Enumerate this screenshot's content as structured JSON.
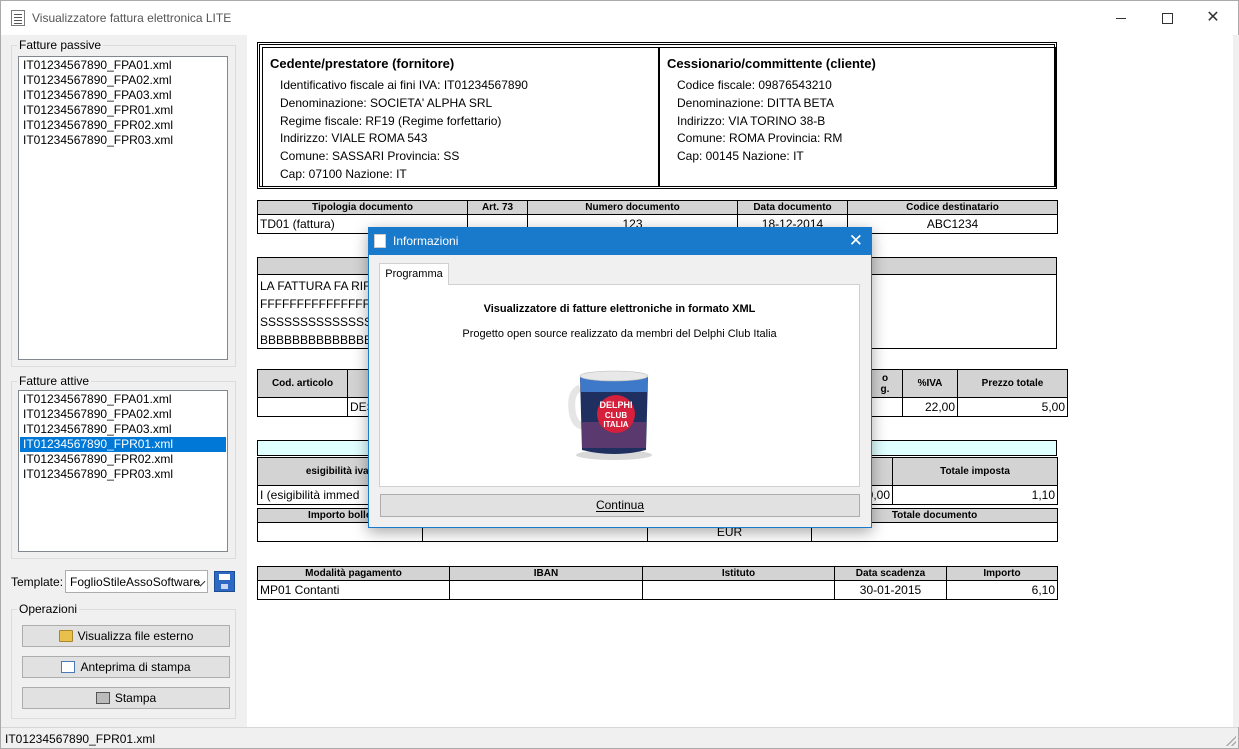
{
  "window": {
    "title": "Visualizzatore fattura elettronica LITE"
  },
  "sidebar": {
    "passive_label": "Fatture passive",
    "passive_items": [
      "IT01234567890_FPA01.xml",
      "IT01234567890_FPA02.xml",
      "IT01234567890_FPA03.xml",
      "IT01234567890_FPR01.xml",
      "IT01234567890_FPR02.xml",
      "IT01234567890_FPR03.xml"
    ],
    "active_label": "Fatture attive",
    "active_items": [
      "IT01234567890_FPA01.xml",
      "IT01234567890_FPA02.xml",
      "IT01234567890_FPA03.xml",
      "IT01234567890_FPR01.xml",
      "IT01234567890_FPR02.xml",
      "IT01234567890_FPR03.xml"
    ],
    "active_selected": "IT01234567890_FPR01.xml",
    "template_label": "Template:",
    "template_value": "FoglioStileAssoSoftware",
    "operations_label": "Operazioni",
    "btn_external": "Visualizza file esterno",
    "btn_preview": "Anteprima di stampa",
    "btn_print": "Stampa"
  },
  "invoice": {
    "cedente": {
      "heading": "Cedente/prestatore (fornitore)",
      "rows": [
        "Identificativo fiscale ai fini IVA: IT01234567890",
        "Denominazione: SOCIETA' ALPHA SRL",
        "Regime fiscale: RF19 (Regime forfettario)",
        "Indirizzo: VIALE ROMA 543",
        "Comune: SASSARI Provincia: SS",
        "Cap: 07100 Nazione: IT"
      ]
    },
    "cessionario": {
      "heading": "Cessionario/committente (cliente)",
      "rows": [
        "Codice fiscale: 09876543210",
        "Denominazione: DITTA BETA",
        "Indirizzo: VIA TORINO 38-B",
        "Comune: ROMA Provincia: RM",
        "Cap: 00145 Nazione: IT"
      ]
    },
    "doc_table": {
      "headers": [
        "Tipologia documento",
        "Art. 73",
        "Numero documento",
        "Data documento",
        "Codice destinatario"
      ],
      "row": [
        "TD01 (fattura)",
        "",
        "123",
        "18-12-2014",
        "ABC1234"
      ]
    },
    "causale_text": "LA FATTURA FA RIF                                                                                          DDDDDD E\nFFFFFFFFFFFFFFFF                                                                                             P QQQQ RRRR\nSSSSSSSSSSSSSSS                                                                                             ARATTERI AAAAAAAAAAA\nBBBBBBBBBBBBBB",
    "lines_table": {
      "headers": [
        "Cod. articolo",
        "",
        "o\ng.",
        "%IVA",
        "Prezzo totale"
      ],
      "row": [
        "",
        "DES",
        "",
        "22,00",
        "5,00"
      ]
    },
    "riepilogo_table": {
      "headers": [
        "esigibilità iva /",
        "",
        "Totale imposta"
      ],
      "row": [
        "I (esigibilità immed",
        "0,00",
        "1,10"
      ]
    },
    "totali_table": {
      "headers": [
        "Importo bollo",
        "",
        "",
        "Totale documento"
      ],
      "row": [
        "",
        "",
        "EUR",
        ""
      ]
    },
    "pagamento_table": {
      "headers": [
        "Modalità pagamento",
        "IBAN",
        "Istituto",
        "Data scadenza",
        "Importo"
      ],
      "row": [
        "MP01 Contanti",
        "",
        "",
        "30-01-2015",
        "6,10"
      ]
    }
  },
  "statusbar": {
    "text": "IT01234567890_FPR01.xml"
  },
  "dialog": {
    "title": "Informazioni",
    "tab": "Programma",
    "heading": "Visualizzatore di fatture elettroniche in formato XML",
    "description": "Progetto open source realizzato da membri del Delphi Club Italia",
    "mug_line1": "DELPHI",
    "mug_line2": "CLUB",
    "mug_line3": "ITALIA",
    "button": "Continua"
  }
}
